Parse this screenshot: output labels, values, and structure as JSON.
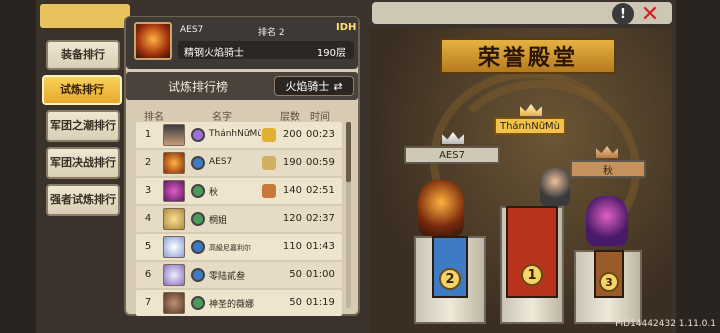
{
  "header": {
    "info_icon": "info-icon",
    "close_icon": "close-icon"
  },
  "side_tabs": [
    {
      "label": "装备排行",
      "active": false
    },
    {
      "label": "试炼排行",
      "active": true
    },
    {
      "label": "军团之潮排行",
      "active": false
    },
    {
      "label": "军团决战排行",
      "active": false
    },
    {
      "label": "强者试炼排行",
      "active": false
    }
  ],
  "my_entry": {
    "name": "AES7",
    "rank_label": "排名 2",
    "badge": "IDH",
    "title": "精钢火焰骑士",
    "floor": "190层"
  },
  "list": {
    "title": "试炼排行榜",
    "class_filter": "火焰骑士",
    "columns": {
      "rank": "排名",
      "name": "名字",
      "floor": "层数",
      "time": "时间"
    },
    "rows": [
      {
        "rank": "1",
        "name": "ThánhNữMù",
        "floor": "200",
        "time": "00:23"
      },
      {
        "rank": "2",
        "name": "AES7",
        "floor": "190",
        "time": "00:59"
      },
      {
        "rank": "3",
        "name": "秋",
        "floor": "140",
        "time": "02:51"
      },
      {
        "rank": "4",
        "name": "桐姐",
        "floor": "120",
        "time": "02:37"
      },
      {
        "rank": "5",
        "name": "高級尼嘉利尔",
        "floor": "110",
        "time": "01:43"
      },
      {
        "rank": "6",
        "name": "零陆貳叁",
        "floor": "50",
        "time": "01:00"
      },
      {
        "rank": "7",
        "name": "神圣的薇娜",
        "floor": "50",
        "time": "01:19"
      }
    ]
  },
  "hall": {
    "title": "荣誉殿堂",
    "first": {
      "name": "ThánhNữMù",
      "place": "1"
    },
    "second": {
      "name": "AES7",
      "place": "2"
    },
    "third": {
      "name": "秋",
      "place": "3"
    }
  },
  "footer": "PID14442432 1.11.0.1",
  "colors": {
    "gold": "#e6a92c",
    "banner_red": "#b8321c",
    "banner_blue": "#3d7bc4",
    "banner_brown": "#9b5a2a"
  }
}
